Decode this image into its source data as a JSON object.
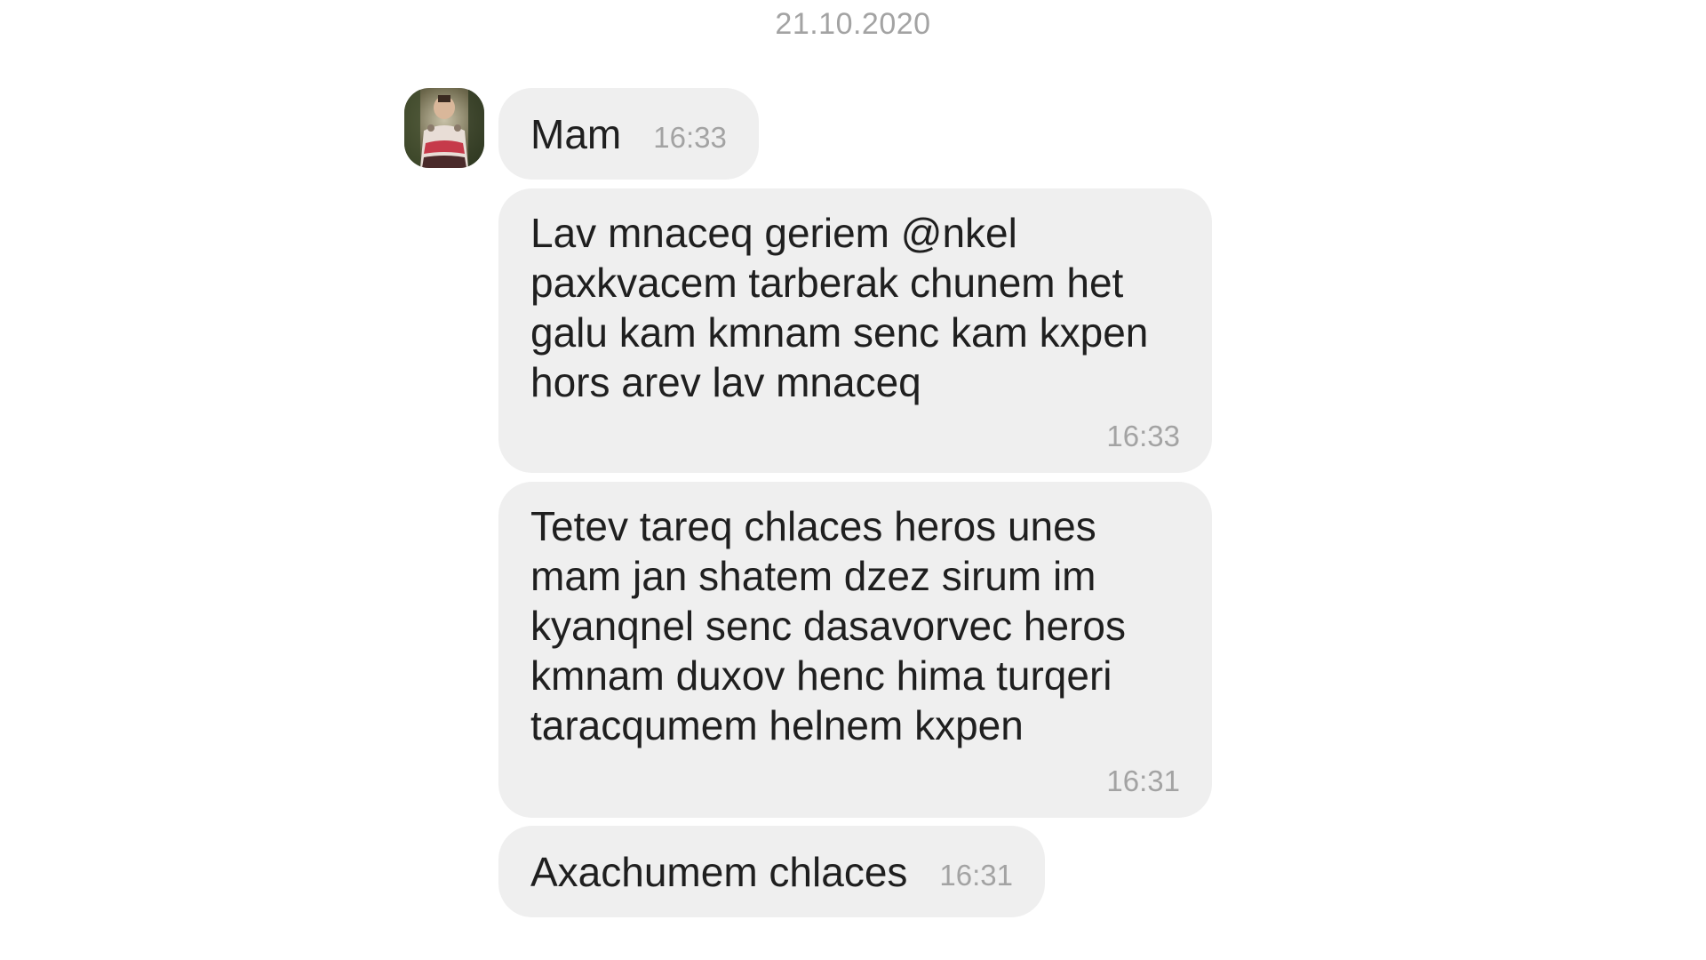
{
  "chat": {
    "date": "21.10.2020",
    "messages": [
      {
        "text": "Mam",
        "time": "16:33"
      },
      {
        "text": "Lav mnaceq geriem @nkel paxkvacem tarberak chunem het galu kam kmnam senc kam kxpen hors arev lav mnaceq",
        "time": "16:33"
      },
      {
        "text": "Tetev tareq chlaces heros unes mam jan shatem dzez sirum im kyanqnel senc dasavorvec heros kmnam duxov henc hima turqeri taracqumem helnem kxpen",
        "time": "16:31"
      },
      {
        "text": "Axachumem chlaces",
        "time": "16:31"
      }
    ]
  },
  "colors": {
    "bubble": "#efefef",
    "meta_text": "#a3a3a3",
    "message_text": "#1f1f1f"
  },
  "icons": {
    "avatar": "sender-avatar-photo"
  }
}
